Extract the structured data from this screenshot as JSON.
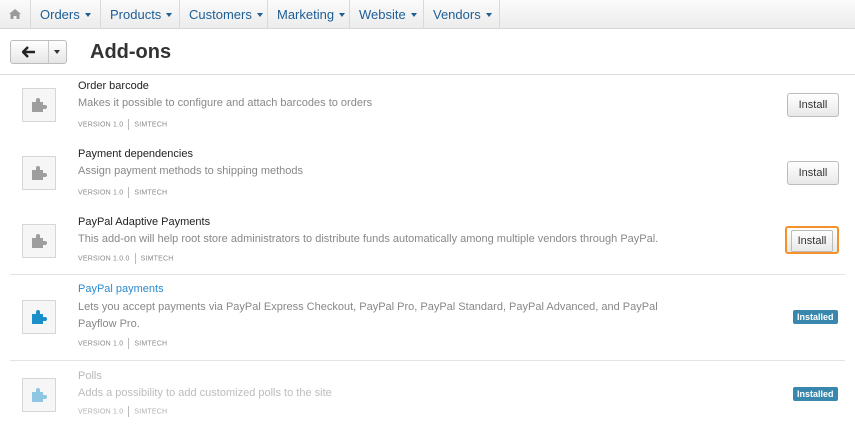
{
  "nav": {
    "items": [
      {
        "label": "Orders"
      },
      {
        "label": "Products"
      },
      {
        "label": "Customers"
      },
      {
        "label": "Marketing"
      },
      {
        "label": "Website"
      },
      {
        "label": "Vendors"
      }
    ]
  },
  "header": {
    "title": "Add-ons"
  },
  "addons": [
    {
      "name": "Order barcode",
      "description": "Makes it possible to configure and attach barcodes to orders",
      "version": "VERSION 1.0",
      "vendor": "SIMTECH",
      "action": "Install"
    },
    {
      "name": "Payment dependencies",
      "description": "Assign payment methods to shipping methods",
      "version": "VERSION 1.0",
      "vendor": "SIMTECH",
      "action": "Install"
    },
    {
      "name": "PayPal Adaptive Payments",
      "description": "This add-on will help root store administrators to distribute funds automatically among multiple vendors through PayPal.",
      "version": "VERSION 1.0.0",
      "vendor": "SIMTECH",
      "action": "Install"
    },
    {
      "name": "PayPal payments",
      "description": "Lets you accept payments via PayPal Express Checkout, PayPal Pro, PayPal Standard, PayPal Advanced, and PayPal Payflow Pro.",
      "version": "VERSION 1.0",
      "vendor": "SIMTECH",
      "status": "Installed"
    },
    {
      "name": "Polls",
      "description": "Adds a possibility to add customized polls to the site",
      "version": "VERSION 1.0",
      "vendor": "SIMTECH",
      "status": "Installed"
    }
  ],
  "colors": {
    "link": "#1d5e96",
    "installed_badge": "#3a87ad",
    "focus_outline": "#f3922b"
  }
}
